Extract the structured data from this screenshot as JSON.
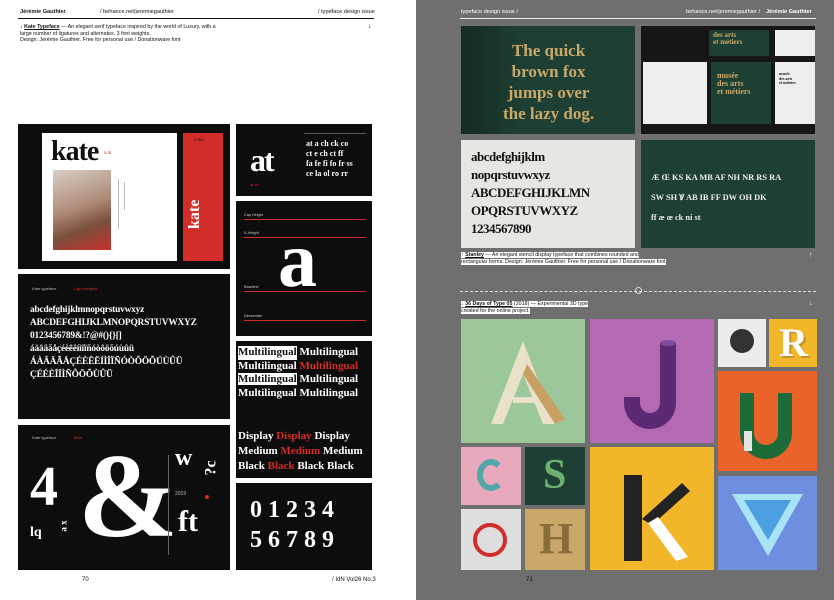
{
  "left": {
    "header": {
      "author": "Jérémie Gauthier",
      "url": "/ behance.net/jeremiegauthier",
      "section": "/ typeface design issue"
    },
    "entry": {
      "arrow": "↓",
      "name": "Kate Typeface",
      "desc1": " — An elegant serif typeface inspired by the world of Luxury, with a",
      "desc2": "large number of ligatures and alternates. 3 font weights.",
      "desc3": "Design: Jérémie Gauthier. Free for personal use / Donationware font",
      "arrow_right": "↓"
    },
    "tiles": {
      "kate_cover": {
        "title": "kate",
        "sub": "a.m",
        "side": "kate",
        "red_small": "a m2"
      },
      "at": {
        "big": "at",
        "row1": "at a ch ck co",
        "row2": "ct e ch ct ff",
        "row3": "fa fe fi fo fr ss",
        "row4": "ce la ol ro rr",
        "caption": "at  ch"
      },
      "a_spec": {
        "glyph": "a",
        "cap": "Cap Height",
        "xh": "X-Height",
        "base": "Baseline",
        "desc": "Descender"
      },
      "alphabet": {
        "label1": "Kate typeface",
        "label2": "Light weights",
        "l1": "abcdefghijklmnopqrstuvwxyz",
        "l2": "ABCDEFGHIJKLMNOPQRSTUVWXYZ",
        "l3": "0123456789&!?@#(){}[]",
        "l4": "áàâäãåçéèêëíìîïñóòôöõúùûü",
        "l5": "ÁÀÂÄÃÅÇÉÈÊËÍÌÎÏÑÓÒÔÖÕÚÙÛÜ",
        "l6": "ÇÉÉÈÎÏÌÑÔÖÕÙÛÜ"
      },
      "multilingual": {
        "word": "Multilingual",
        "d1": "Display",
        "d2": "Medium",
        "d3": "Black"
      },
      "ampersand": {
        "label1": "Kate typeface",
        "label2": "Bold",
        "num": "4",
        "amp": "&",
        "w": "w",
        "qc": "?c",
        "ft": "ft",
        "year": "2019",
        "lq": "lq",
        "ax": "a x"
      },
      "numbers": {
        "r1": "0 1 2 3 4",
        "r2": "5 6 7 8 9"
      }
    },
    "folio": {
      "page": "70",
      "mag": "/ IdN Vol26 No.3"
    }
  },
  "right": {
    "header": {
      "section": "typeface design issue /",
      "url": "behance.net/jeremiegauthier /",
      "author": "Jérémie Gauthier"
    },
    "tiles": {
      "quick": {
        "l1": "The quick",
        "l2": "brown fox",
        "l3": "jumps over",
        "l4": "the lazy dog."
      },
      "cards": {
        "name1": "musée",
        "name2": "des arts",
        "name3": "et métiers"
      },
      "stanley_alpha": {
        "l1": "abcdefghijklm",
        "l2": "nopqrstuvwxyz",
        "l3": "ABCDEFGHIJKLMN",
        "l4": "OPQRSTUVWXYZ",
        "l5": "1234567890"
      },
      "ligs": {
        "l1": "Æ Œ KS KA MB AF NH NR RS RA",
        "l2": "SW SH Ꝟ AB IB FF DW OH DK",
        "l3": "ff æ œ ck ni st"
      }
    },
    "stanley": {
      "arrow": "↑",
      "name": "Stanley",
      "desc1": " — An elegant stencil display typeface that combines rounded and",
      "desc2": "rectangular forms. Design: Jérémie Gauthier. Free for personal use / Donationware font",
      "arrow_right": "↑"
    },
    "days": {
      "arrow": "↓",
      "name": "36 Days of Type 05",
      "desc1": " (2018) — Experimental 3D type",
      "desc2": "created for the online project.",
      "arrow_right": "↓"
    },
    "folio": {
      "page": "71"
    }
  },
  "colors": {
    "red": "#d32d2a",
    "green": "#1e3f33",
    "gold": "#c9a86a",
    "sage": "#9cc79b",
    "purple": "#b46ab2",
    "orange": "#e9632b",
    "pink": "#e9a9bd",
    "yellow": "#f2b62b",
    "blue": "#6e8fe0"
  }
}
